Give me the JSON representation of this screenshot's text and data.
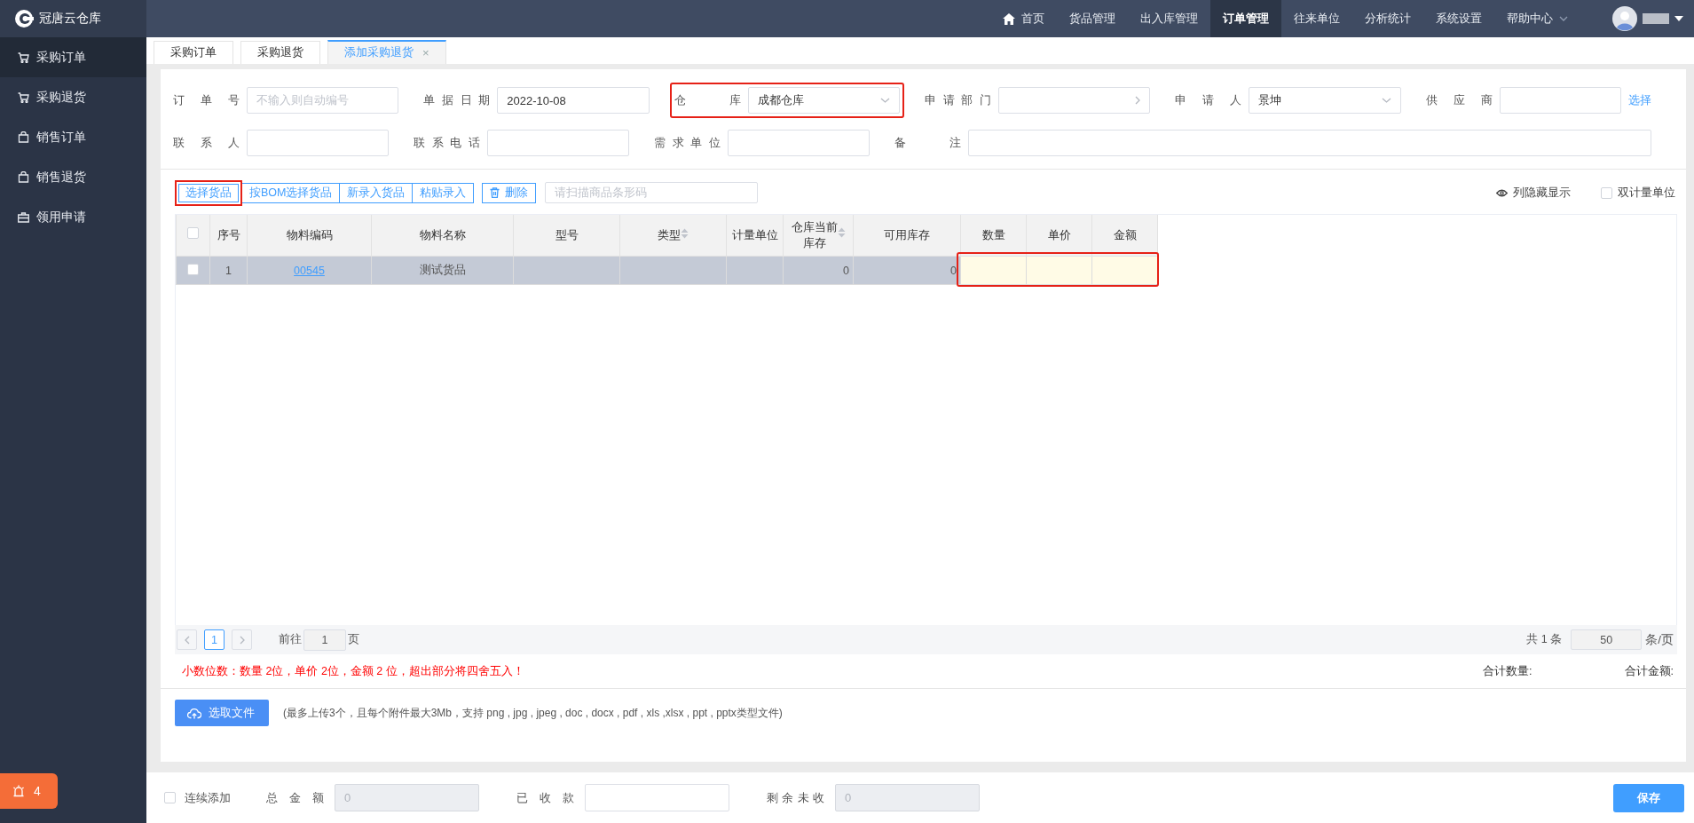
{
  "logo": {
    "title": "冠唐云仓库"
  },
  "top_nav": [
    {
      "label": "首页",
      "selected": false,
      "dropdown": false
    },
    {
      "label": "货品管理",
      "selected": false,
      "dropdown": false
    },
    {
      "label": "出入库管理",
      "selected": false,
      "dropdown": false
    },
    {
      "label": "订单管理",
      "selected": true,
      "dropdown": false
    },
    {
      "label": "往来单位",
      "selected": false,
      "dropdown": false
    },
    {
      "label": "分析统计",
      "selected": false,
      "dropdown": false
    },
    {
      "label": "系统设置",
      "selected": false,
      "dropdown": false
    },
    {
      "label": "帮助中心",
      "selected": false,
      "dropdown": true
    }
  ],
  "sidebar": {
    "items": [
      {
        "label": "采购订单",
        "selected": true
      },
      {
        "label": "采购退货",
        "selected": false
      },
      {
        "label": "销售订单",
        "selected": false
      },
      {
        "label": "销售退货",
        "selected": false
      },
      {
        "label": "领用申请",
        "selected": false
      }
    ]
  },
  "badge": {
    "count": "4"
  },
  "page_tabs": [
    {
      "label": "采购订单",
      "selected": false
    },
    {
      "label": "采购退货",
      "selected": false
    },
    {
      "label": "添加采购退货",
      "selected": true,
      "close": "×"
    }
  ],
  "form": {
    "rows": [
      [
        {
          "label": "订单号",
          "kind": "input",
          "placeholder": "不输入则自动编号",
          "highlighted": false
        },
        {
          "label": "单据日期",
          "kind": "input",
          "value": "2022-10-08",
          "highlighted": false
        },
        {
          "label": "仓库",
          "kind": "select",
          "value": "成都仓库",
          "highlighted": true
        },
        {
          "label": "申请部门",
          "kind": "picker",
          "highlighted": false
        },
        {
          "label": "申请人",
          "kind": "select",
          "value": "景坤",
          "highlighted": false
        },
        {
          "label": "供应商",
          "kind": "input",
          "link": "选择",
          "highlighted": false
        }
      ],
      [
        {
          "label": "联系人",
          "kind": "input",
          "highlighted": false
        },
        {
          "label": "联系电话",
          "kind": "input",
          "highlighted": false
        },
        {
          "label": "需求单位",
          "kind": "input",
          "highlighted": false
        },
        {
          "label": "备注",
          "kind": "wide",
          "highlighted": false
        }
      ]
    ]
  },
  "toolbar": {
    "buttons": [
      {
        "label": "选择货品",
        "kind": "group",
        "highlighted": true
      },
      {
        "label": "按BOM选择货品",
        "kind": "group",
        "highlighted": false
      },
      {
        "label": "新录入货品",
        "kind": "group",
        "highlighted": false
      },
      {
        "label": "粘贴录入",
        "kind": "group",
        "highlighted": false
      },
      {
        "label": "删除",
        "kind": "delete",
        "highlighted": false
      }
    ],
    "scan": {
      "placeholder": "请扫描商品条形码"
    },
    "column_toggle": "列隐藏显示",
    "dual_unit": {
      "label": "双计量单位",
      "checked": false
    }
  },
  "table": {
    "all_checked": false,
    "editable_highlighted": true,
    "columns": [
      {
        "label": "序号",
        "sortable": false,
        "editable": false
      },
      {
        "label": "物料编码",
        "sortable": false,
        "editable": false
      },
      {
        "label": "物料名称",
        "sortable": false,
        "editable": false
      },
      {
        "label": "型号",
        "sortable": false,
        "editable": false
      },
      {
        "label": "类型",
        "sortable": true,
        "editable": false
      },
      {
        "label": "计量单位",
        "sortable": false,
        "editable": false
      },
      {
        "label": "仓库当前库存",
        "sortable": true,
        "editable": false
      },
      {
        "label": "可用库存",
        "sortable": false,
        "editable": false
      },
      {
        "label": "数量",
        "sortable": false,
        "editable": true
      },
      {
        "label": "单价",
        "sortable": false,
        "editable": true
      },
      {
        "label": "金额",
        "sortable": false,
        "editable": true
      }
    ],
    "rows": [
      {
        "checked": false,
        "highlighted": true,
        "cells": [
          "1",
          "00545",
          "测试货品",
          null,
          null,
          null,
          "0",
          "0",
          null,
          null,
          null
        ]
      }
    ]
  },
  "pagination": {
    "pages": [
      {
        "label": "1",
        "selected": true
      }
    ],
    "goto_label": "前往",
    "goto_value": "1",
    "page_suffix": "页",
    "total": "共 1 条",
    "page_size": "50",
    "page_size_suffix": "条/页"
  },
  "note": "小数位数：数量 2位，单价 2位，金额 2 位，超出部分将四舍五入！",
  "totals": [
    "合计数量:",
    "合计金额:"
  ],
  "upload": {
    "button": "选取文件",
    "hint": "(最多上传3个，且每个附件最大3Mb，支持 png , jpg , jpeg , doc , docx , pdf , xls ,xlsx , ppt , pptx类型文件)"
  },
  "footer": {
    "continuous": {
      "label": "连续添加",
      "checked": false
    },
    "fields": [
      {
        "label": "总金额",
        "value": "0",
        "disabled": true
      },
      {
        "label": "已收款",
        "disabled": false
      },
      {
        "label": "剩余未收",
        "value": "0",
        "disabled": true
      }
    ],
    "save": "保存"
  }
}
